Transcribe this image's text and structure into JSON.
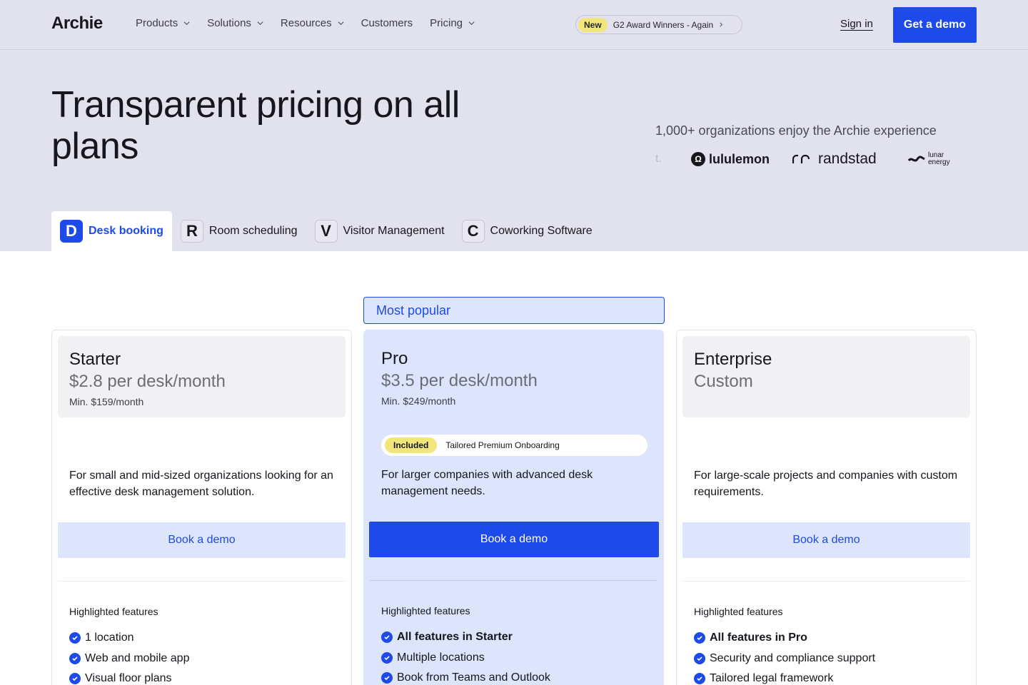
{
  "header": {
    "logo": "Archie",
    "nav": [
      {
        "label": "Products",
        "dropdown": true
      },
      {
        "label": "Solutions",
        "dropdown": true
      },
      {
        "label": "Resources",
        "dropdown": true
      },
      {
        "label": "Customers",
        "dropdown": false
      },
      {
        "label": "Pricing",
        "dropdown": true
      }
    ],
    "announcement": {
      "tag": "New",
      "text": "G2 Award Winners - Again"
    },
    "sign_in": "Sign in",
    "cta": "Get a demo"
  },
  "hero": {
    "title": "Transparent pricing on all plans",
    "trust_text": "1,000+ organizations enjoy the Archie experience",
    "logos": {
      "partial": "t.",
      "lululemon": "lululemon",
      "randstad": "randstad",
      "lunar_line1": "lunar",
      "lunar_line2": "energy"
    }
  },
  "tabs": [
    {
      "letter": "D",
      "label": "Desk booking",
      "active": true
    },
    {
      "letter": "R",
      "label": "Room scheduling",
      "active": false
    },
    {
      "letter": "V",
      "label": "Visitor Management",
      "active": false
    },
    {
      "letter": "C",
      "label": "Coworking Software",
      "active": false
    }
  ],
  "plans": {
    "most_popular": "Most popular",
    "starter": {
      "name": "Starter",
      "price": "$2.8 per desk/month",
      "min": "Min. $159/month",
      "description": "For small and mid-sized organizations looking for an effective desk management solution.",
      "button": "Book a demo",
      "features_heading": "Highlighted features",
      "features": [
        "1 location",
        "Web and mobile app",
        "Visual floor plans"
      ]
    },
    "pro": {
      "name": "Pro",
      "price": "$3.5 per desk/month",
      "min": "Min. $249/month",
      "included_tag": "Included",
      "included_text": "Tailored Premium Onboarding",
      "description": "For larger companies with advanced desk management needs.",
      "button": "Book a demo",
      "features_heading": "Highlighted features",
      "features": [
        "All features in Starter",
        "Multiple locations",
        "Book from Teams and Outlook"
      ]
    },
    "enterprise": {
      "name": "Enterprise",
      "price": "Custom",
      "description": "For large-scale projects and companies with custom requirements.",
      "button": "Book a demo",
      "features_heading": "Highlighted features",
      "features": [
        "All features in Pro",
        "Security and compliance support",
        "Tailored legal framework"
      ]
    }
  },
  "colors": {
    "accent": "#1d4ae8",
    "hero_bg": "#e2e1ee",
    "pro_bg": "#dce5fc",
    "badge_yellow": "#f2e67a"
  }
}
